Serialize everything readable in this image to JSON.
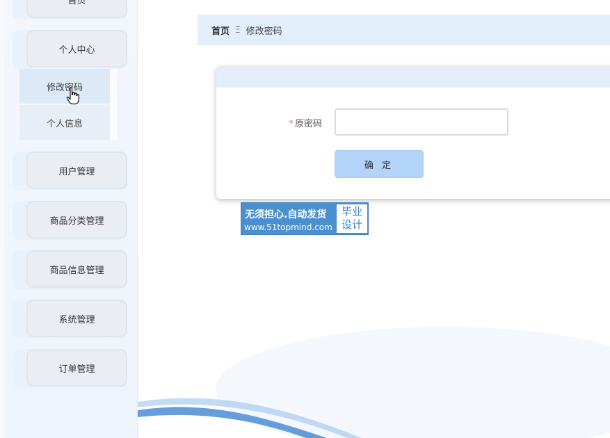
{
  "sidebar": {
    "items": [
      {
        "label": "首页"
      },
      {
        "label": "个人中心"
      },
      {
        "label": "用户管理"
      },
      {
        "label": "商品分类管理"
      },
      {
        "label": "商品信息管理"
      },
      {
        "label": "系统管理"
      },
      {
        "label": "订单管理"
      }
    ],
    "submenu": [
      {
        "label": "修改密码",
        "active": true
      },
      {
        "label": "个人信息",
        "active": false
      }
    ]
  },
  "breadcrumb": {
    "home": "首页",
    "separator": "Ξ",
    "current": "修改密码"
  },
  "form": {
    "required_mark": "*",
    "old_password_label": "原密码",
    "old_password_value": "",
    "confirm_label": "确 定"
  },
  "badge": {
    "line1": "无须担心.自动发货",
    "line2": "www.51topmind.com",
    "right_top": "毕业",
    "right_bottom": "设计"
  },
  "colors": {
    "accent_light": "#e3eefb",
    "button": "#b2d4f9",
    "required": "#f56c6c",
    "badge_blue": "#4a8fd0"
  }
}
